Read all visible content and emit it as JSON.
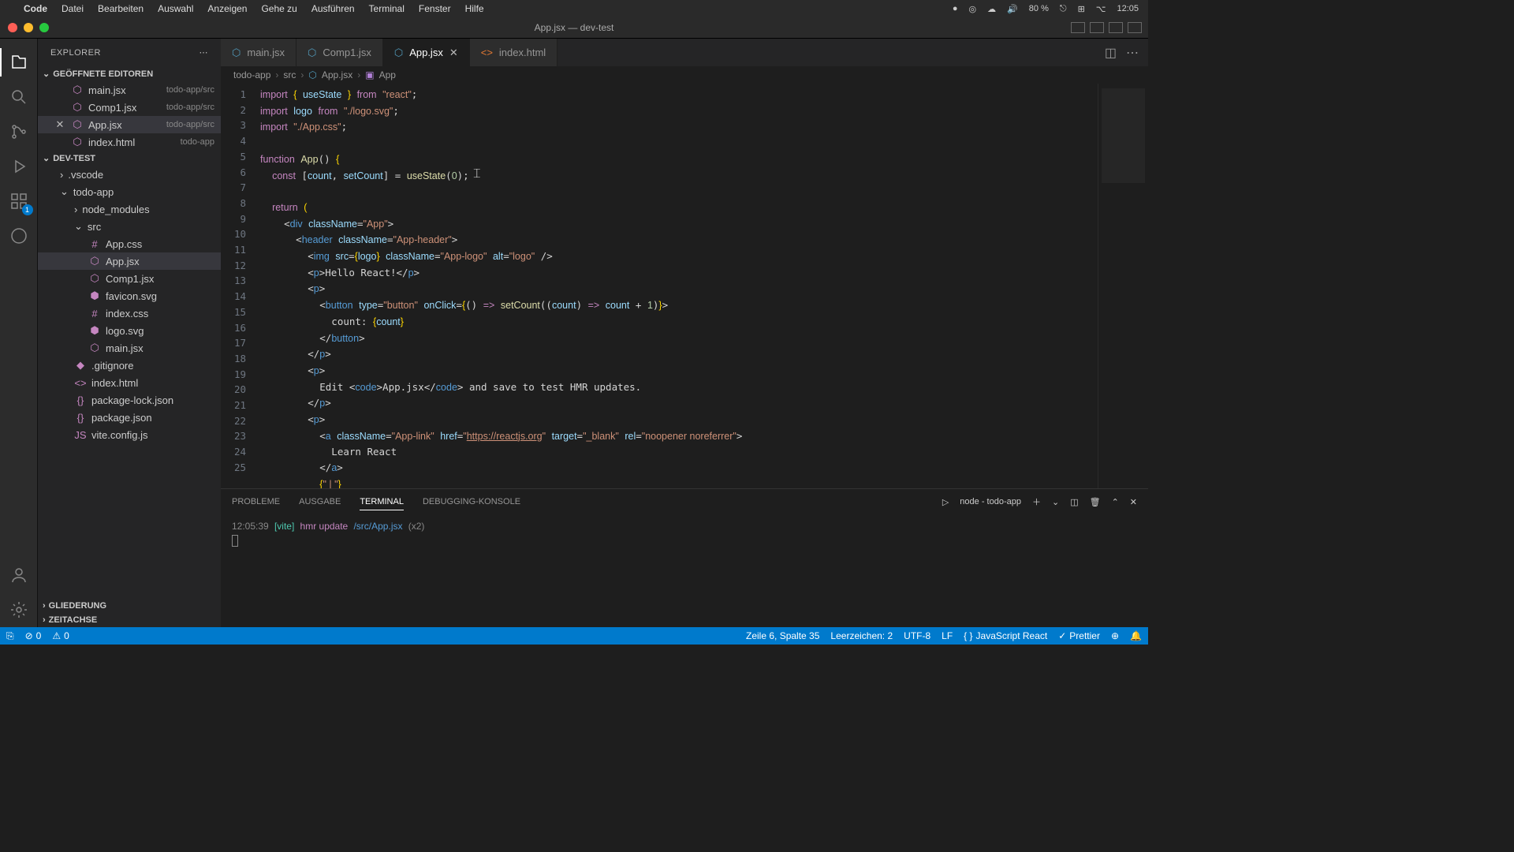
{
  "menubar": {
    "app": "Code",
    "items": [
      "Datei",
      "Bearbeiten",
      "Auswahl",
      "Anzeigen",
      "Gehe zu",
      "Ausführen",
      "Terminal",
      "Fenster",
      "Hilfe"
    ],
    "right": {
      "battery": "80 %",
      "clock": "12:05",
      "date_icon": "📅",
      "icons": [
        "🔴",
        "◎",
        "☁︎",
        "🔊",
        "🔋",
        "⚙"
      ]
    }
  },
  "window": {
    "title": "App.jsx — dev-test"
  },
  "activity": {
    "badge": "1"
  },
  "explorer": {
    "title": "EXPLORER",
    "openEditors": {
      "title": "GEÖFFNETE EDITOREN",
      "items": [
        {
          "name": "main.jsx",
          "path": "todo-app/src"
        },
        {
          "name": "Comp1.jsx",
          "path": "todo-app/src"
        },
        {
          "name": "App.jsx",
          "path": "todo-app/src",
          "active": true
        },
        {
          "name": "index.html",
          "path": "todo-app"
        }
      ]
    },
    "section": {
      "title": "DEV-TEST"
    },
    "tree": [
      {
        "t": "folder",
        "n": ".vscode",
        "d": 1
      },
      {
        "t": "folder",
        "n": "todo-app",
        "d": 1,
        "open": true
      },
      {
        "t": "folder",
        "n": "node_modules",
        "d": 2
      },
      {
        "t": "folder",
        "n": "src",
        "d": 2,
        "open": true
      },
      {
        "t": "file",
        "n": "App.css",
        "d": 3,
        "c": "css"
      },
      {
        "t": "file",
        "n": "App.jsx",
        "d": 3,
        "c": "jsx",
        "sel": true
      },
      {
        "t": "file",
        "n": "Comp1.jsx",
        "d": 3,
        "c": "jsx"
      },
      {
        "t": "file",
        "n": "favicon.svg",
        "d": 3,
        "c": "svg"
      },
      {
        "t": "file",
        "n": "index.css",
        "d": 3,
        "c": "css"
      },
      {
        "t": "file",
        "n": "logo.svg",
        "d": 3,
        "c": "svg"
      },
      {
        "t": "file",
        "n": "main.jsx",
        "d": 3,
        "c": "jsx"
      },
      {
        "t": "file",
        "n": ".gitignore",
        "d": 2,
        "c": "txt"
      },
      {
        "t": "file",
        "n": "index.html",
        "d": 2,
        "c": "html"
      },
      {
        "t": "file",
        "n": "package-lock.json",
        "d": 2,
        "c": "json"
      },
      {
        "t": "file",
        "n": "package.json",
        "d": 2,
        "c": "json"
      },
      {
        "t": "file",
        "n": "vite.config.js",
        "d": 2,
        "c": "js"
      }
    ],
    "outline": "GLIEDERUNG",
    "timeline": "ZEITACHSE"
  },
  "tabs": [
    {
      "n": "main.jsx",
      "c": "jsx"
    },
    {
      "n": "Comp1.jsx",
      "c": "jsx"
    },
    {
      "n": "App.jsx",
      "c": "jsx",
      "active": true,
      "close": true
    },
    {
      "n": "index.html",
      "c": "html"
    }
  ],
  "breadcrumb": [
    "todo-app",
    "src",
    "App.jsx",
    "App"
  ],
  "code": {
    "lines": 25,
    "raw": [
      "import { useState } from \"react\";",
      "import logo from \"./logo.svg\";",
      "import \"./App.css\";",
      "",
      "function App() {",
      "  const [count, setCount] = useState(0);",
      "",
      "  return (",
      "    <div className=\"App\">",
      "      <header className=\"App-header\">",
      "        <img src={logo} className=\"App-logo\" alt=\"logo\" />",
      "        <p>Hello React!</p>",
      "        <p>",
      "          <button type=\"button\" onClick={() => setCount((count) => count + 1)}>",
      "            count: {count}",
      "          </button>",
      "        </p>",
      "        <p>",
      "          Edit <code>App.jsx</code> and save to test HMR updates.",
      "        </p>",
      "        <p>",
      "          <a className=\"App-link\" href=\"https://reactjs.org\" target=\"_blank\" rel=\"noopener noreferrer\">",
      "            Learn React",
      "          </a>",
      "          {\" | \"}"
    ]
  },
  "panel": {
    "tabs": [
      "PROBLEME",
      "AUSGABE",
      "TERMINAL",
      "DEBUGGING-KONSOLE"
    ],
    "active": "TERMINAL",
    "termLabel": "node - todo-app",
    "line": {
      "ts": "12:05:39",
      "vite": "[vite]",
      "msg": "hmr update",
      "path": "/src/App.jsx",
      "extra": "(x2)"
    }
  },
  "status": {
    "errors": "0",
    "warnings": "0",
    "pos": "Zeile 6, Spalte 35",
    "spaces": "Leerzeichen: 2",
    "enc": "UTF-8",
    "eol": "LF",
    "lang": "JavaScript React",
    "prettier": "Prettier"
  }
}
